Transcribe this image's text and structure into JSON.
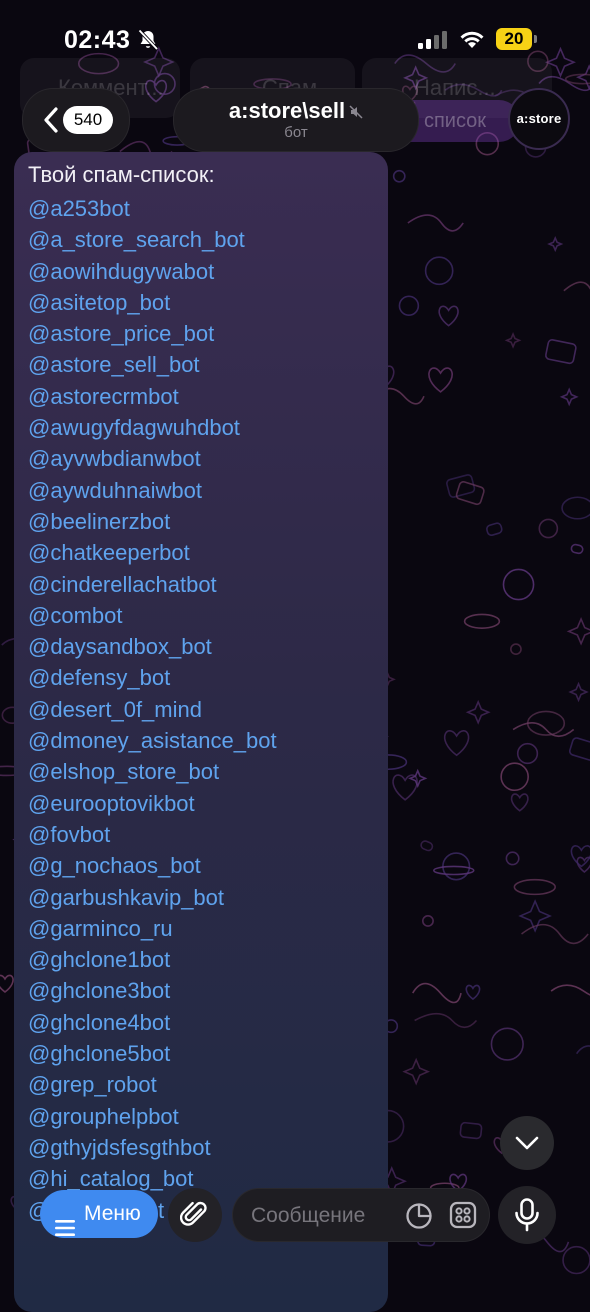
{
  "status_bar": {
    "time": "02:43",
    "battery": "20",
    "battery_color": "#f7d215"
  },
  "pinned_ghost": {
    "comments_label": "Коммент...",
    "spam_label": "Спам",
    "write_label": "Напис..."
  },
  "header": {
    "back_badge": "540",
    "title": "a:store\\sell",
    "subtitle": "бот",
    "ghost_button_label": "список",
    "avatar_text": "a:store"
  },
  "message": {
    "heading": "Твой спам-список:",
    "bots": [
      "@a253bot",
      "@a_store_search_bot",
      "@aowihdugywabot",
      "@asitetop_bot",
      "@astore_price_bot",
      "@astore_sell_bot",
      "@astorecrmbot",
      "@awugyfdagwuhdbot",
      "@ayvwbdianwbot",
      "@aywduhnaiwbot",
      "@beelinerzbot",
      "@chatkeeperbot",
      "@cinderellachatbot",
      "@combot",
      "@daysandbox_bot",
      "@defensy_bot",
      "@desert_0f_mind",
      "@dmoney_asistance_bot",
      "@elshop_store_bot",
      "@eurooptovikbot",
      "@fovbot",
      "@g_nochaos_bot",
      "@garbushkavip_bot",
      "@garminco_ru",
      "@ghclone1bot",
      "@ghclone3bot",
      "@ghclone4bot",
      "@ghclone5bot",
      "@grep_robot",
      "@grouphelpbot",
      "@gthyjdsfesgthbot",
      "@hi_catalog_bot",
      "@infoeasabot"
    ],
    "link_color": "#5fa3ee"
  },
  "composer": {
    "menu_label": "Меню",
    "placeholder": "Сообщение",
    "accent_color": "#3f8af0"
  },
  "icons": {
    "back": "chevron-left-icon",
    "mute": "muted-speaker-icon",
    "scroll": "chevron-down-icon",
    "menu": "hamburger-icon",
    "attach": "paperclip-icon",
    "sticker": "sticker-icon",
    "emoji": "emoji-grid-icon",
    "mic": "microphone-icon"
  }
}
